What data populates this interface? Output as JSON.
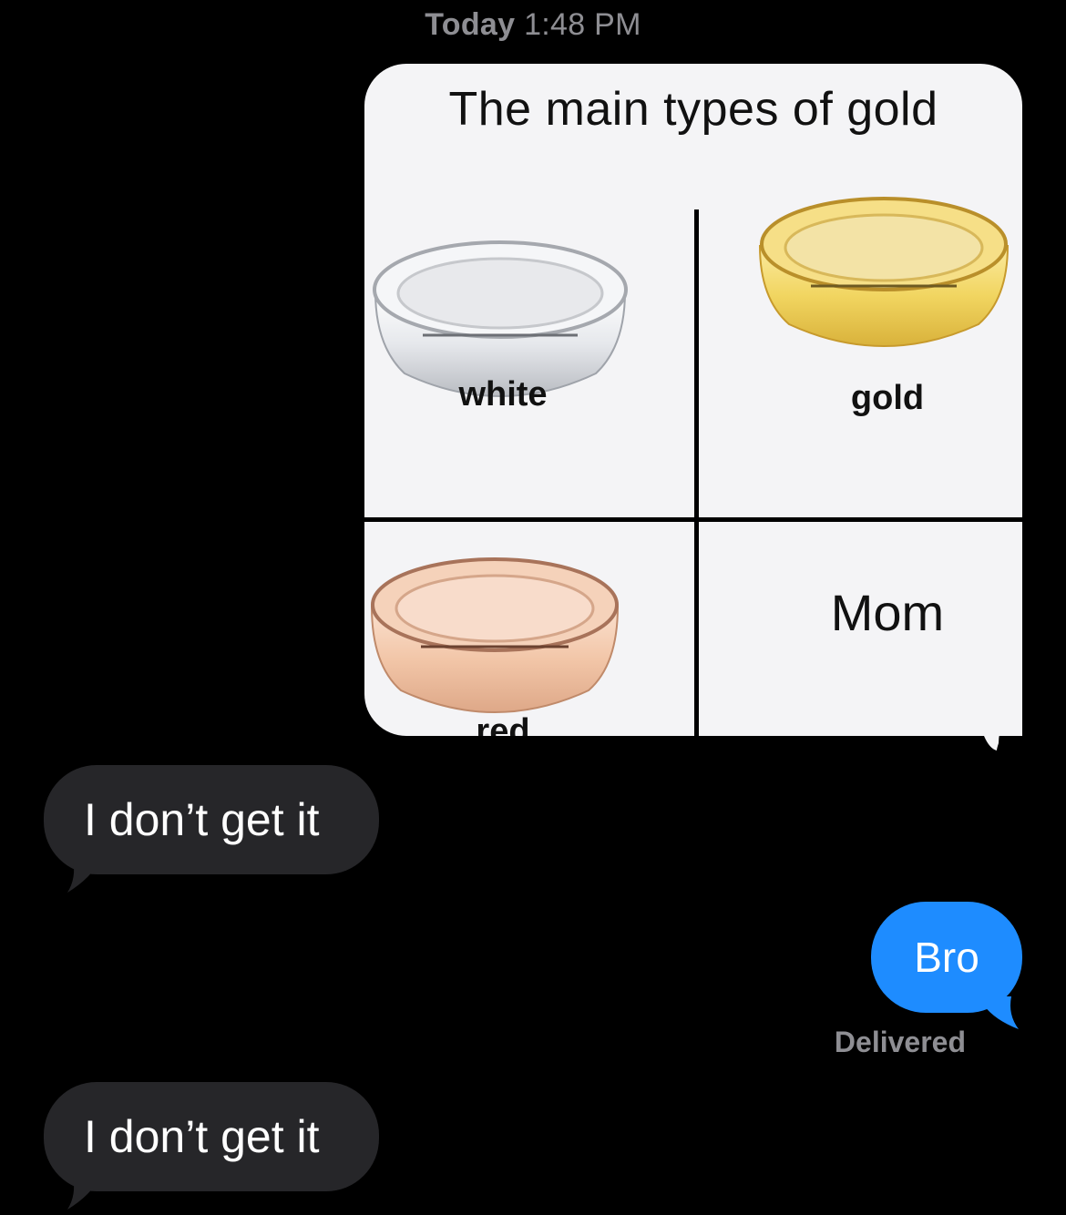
{
  "conversation": {
    "timestamp_day": "Today",
    "timestamp_time": "1:48 PM"
  },
  "meme": {
    "title": "The main types of gold",
    "cells": [
      {
        "label": "white",
        "ring_color": "#e4e6ea"
      },
      {
        "label": "gold",
        "ring_color": "#f4d86a"
      },
      {
        "label": "red",
        "ring_color": "#f1c3a3"
      },
      {
        "label": "Mom"
      }
    ]
  },
  "messages": [
    {
      "direction": "incoming",
      "text": "I don’t get it"
    },
    {
      "direction": "outgoing",
      "text": "Bro",
      "status": "Delivered"
    },
    {
      "direction": "incoming",
      "text": "I don’t get it"
    }
  ],
  "colors": {
    "background": "#000000",
    "incoming_bubble": "#262629",
    "outgoing_bubble": "#1e8cff",
    "meta_text": "#8e8e93"
  }
}
